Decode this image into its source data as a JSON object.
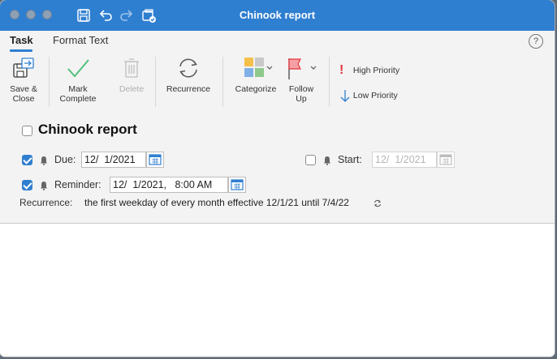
{
  "window": {
    "title": "Chinook report"
  },
  "tabs": [
    {
      "label": "Task",
      "active": true
    },
    {
      "label": "Format Text",
      "active": false
    }
  ],
  "help_label": "?",
  "ribbon": {
    "save_close": {
      "line1": "Save &",
      "line2": "Close",
      "icon": "save-close-icon"
    },
    "mark_complete": {
      "line1": "Mark",
      "line2": "Complete",
      "icon": "checkmark-icon"
    },
    "delete": {
      "label": "Delete",
      "icon": "trash-icon"
    },
    "recurrence": {
      "label": "Recurrence",
      "icon": "recurrence-icon"
    },
    "categorize": {
      "label": "Categorize",
      "icon": "categorize-icon"
    },
    "follow_up": {
      "line1": "Follow",
      "line2": "Up",
      "icon": "flag-icon"
    },
    "high_priority": {
      "label": "High Priority",
      "icon": "exclamation-icon"
    },
    "low_priority": {
      "label": "Low Priority",
      "icon": "down-arrow-icon"
    }
  },
  "task": {
    "subject": "Chinook report",
    "completed": false,
    "due": {
      "label": "Due:",
      "checked": true,
      "value": "12/  1/2021"
    },
    "start": {
      "label": "Start:",
      "checked": false,
      "value": "12/  1/2021"
    },
    "reminder": {
      "label": "Reminder:",
      "checked": true,
      "value": "12/  1/2021,   8:00 AM"
    },
    "recurrence": {
      "label": "Recurrence:",
      "value": "the first weekday of every month effective 12/1/21 until 7/4/22"
    }
  },
  "colors": {
    "accent": "#2f7fd1",
    "flag": "#e2343b",
    "check": "#4fbf7a",
    "priority_high": "#e2343b",
    "priority_low": "#2f7fd1"
  }
}
